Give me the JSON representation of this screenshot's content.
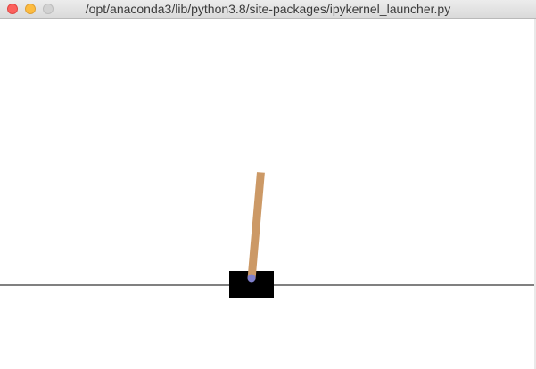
{
  "window": {
    "title": "/opt/anaconda3/lib/python3.8/site-packages/ipykernel_launcher.py"
  },
  "icons": {
    "close": "close-button",
    "minimize": "minimize-button",
    "zoom": "zoom-button"
  },
  "colors": {
    "track": "#000000",
    "cart": "#000000",
    "pole": "#cc9966",
    "axle": "#8080cc",
    "close": "#fc615d",
    "minimize": "#fdbc40",
    "zoom": "#d2d2d2"
  },
  "scene": {
    "pole_angle_deg": 5
  }
}
